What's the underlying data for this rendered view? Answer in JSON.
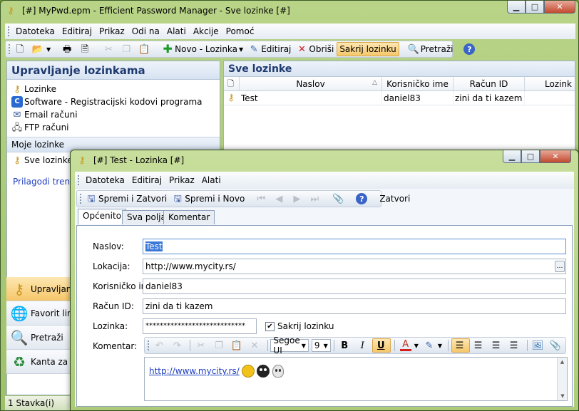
{
  "main_window": {
    "title": "[#] MyPwd.epm - Efficient Password Manager - Sve lozinke [#]",
    "menu": [
      "Datoteka",
      "Editiraj",
      "Prikaz",
      "Odi na",
      "Alati",
      "Akcije",
      "Pomoć"
    ],
    "toolbar": {
      "new_entry": "Novo - Lozinka",
      "edit": "Editiraj",
      "delete": "Obriši",
      "hide_passwords": "Sakrij lozinku",
      "search": "Pretraži"
    },
    "sidebar": {
      "title": "Upravljanje lozinkama",
      "categories": [
        "Lozinke",
        "Software - Registracijski kodovi programa",
        "Email računi",
        "FTP računi"
      ],
      "my_section": "Moje lozinke",
      "my_items": [
        "Sve lozinke"
      ],
      "customize_link": "Prilagodi trenut",
      "nav_buttons": [
        "Upravljanje",
        "Favorit lin",
        "Pretraži",
        "Kanta za s"
      ]
    },
    "list": {
      "title": "Sve lozinke",
      "columns": [
        "Naslov",
        "Korisničko ime",
        "Račun ID",
        "Lozink"
      ],
      "rows": [
        {
          "title": "Test",
          "username": "daniel83",
          "account": "zini da ti kazem",
          "password": ""
        }
      ]
    },
    "status": "1 Stavka(i)"
  },
  "dialog": {
    "title": "[#] Test - Lozinka [#]",
    "menu": [
      "Datoteka",
      "Editiraj",
      "Prikaz",
      "Alati"
    ],
    "toolbar": {
      "save_close": "Spremi i Zatvori",
      "save_new": "Spremi i Novo",
      "close": "Zatvori"
    },
    "tabs": [
      "Općenito",
      "Sva polja",
      "Komentar"
    ],
    "fields": {
      "title_label": "Naslov:",
      "title_value": "Test",
      "location_label": "Lokacija:",
      "location_value": "http://www.mycity.rs/",
      "username_label": "Korisničko ime",
      "username_value": "daniel83",
      "account_label": "Račun ID:",
      "account_value": "zini da ti kazem",
      "password_label": "Lozinka:",
      "password_value": "****************************",
      "hide_checkbox": "Sakrij lozinku",
      "comment_label": "Komentar:"
    },
    "editor": {
      "font": "Segoe UI",
      "size": "9",
      "content_link": "http://www.mycity.rs/"
    }
  }
}
